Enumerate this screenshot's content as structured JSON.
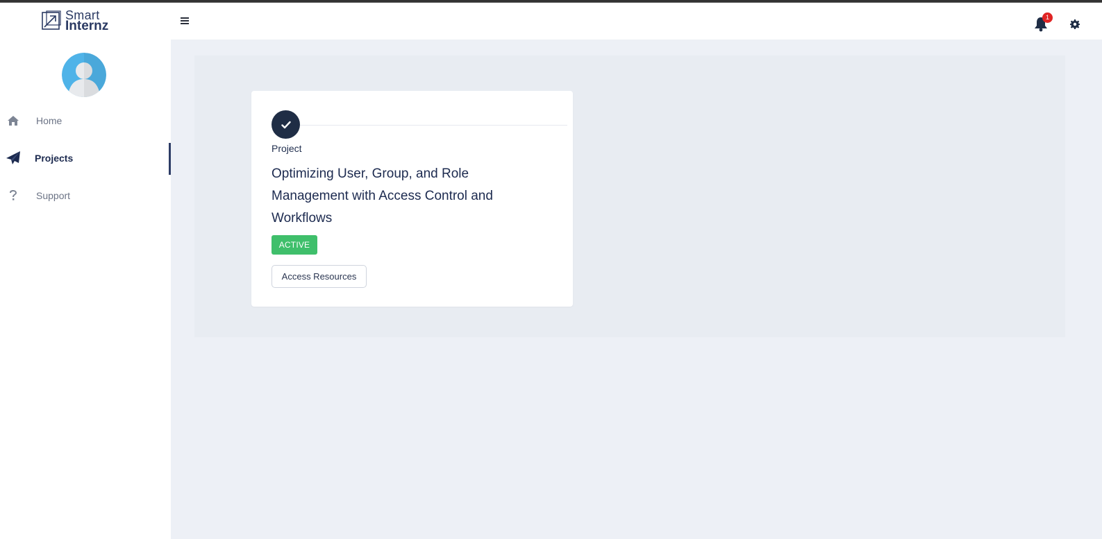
{
  "brand": {
    "line1": "Smart",
    "line2": "Internz"
  },
  "sidebar": {
    "items": [
      {
        "label": "Home",
        "icon": "home-icon"
      },
      {
        "label": "Projects",
        "icon": "paper-plane-icon",
        "active": true
      },
      {
        "label": "Support",
        "icon": "question-icon"
      }
    ]
  },
  "header": {
    "menu_icon": "hamburger-icon",
    "notifications": {
      "icon": "bell-icon",
      "count": "1"
    },
    "settings_icon": "gear-icon"
  },
  "project_card": {
    "kicker": "Project",
    "title": "Optimizing User, Group, and Role Management with Access Control and Workflows",
    "status": "ACTIVE",
    "action_label": "Access Resources"
  },
  "colors": {
    "accent": "#1f2d45",
    "active_status": "#3fbf6b",
    "notification": "#e02424",
    "page_background": "#edf0f6"
  }
}
